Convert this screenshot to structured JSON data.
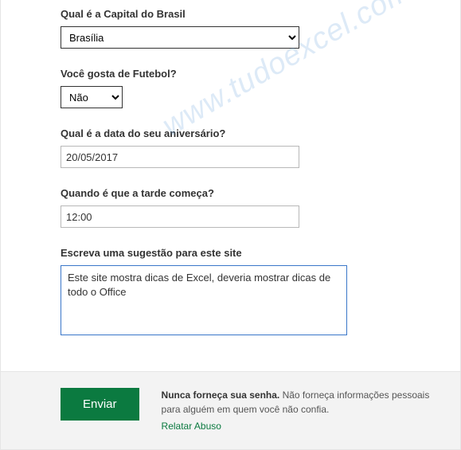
{
  "watermark": "www.tudoexcel.com.br",
  "fields": {
    "capital": {
      "label": "Qual é a Capital do Brasil",
      "value": "Brasília"
    },
    "futebol": {
      "label": "Você gosta de Futebol?",
      "value": "Não"
    },
    "aniversario": {
      "label": "Qual é a data do seu aniversário?",
      "value": "20/05/2017"
    },
    "tarde": {
      "label": "Quando é que a tarde começa?",
      "value": "12:00"
    },
    "sugestao": {
      "label": "Escreva uma sugestão para este site",
      "value": "Este site mostra dicas de Excel, deveria mostrar dicas de todo o Office"
    }
  },
  "footer": {
    "submit": "Enviar",
    "warn_bold": "Nunca forneça sua senha.",
    "warn_rest": " Não forneça informações pessoais para alguém em quem você não confia.",
    "report": "Relatar Abuso"
  }
}
